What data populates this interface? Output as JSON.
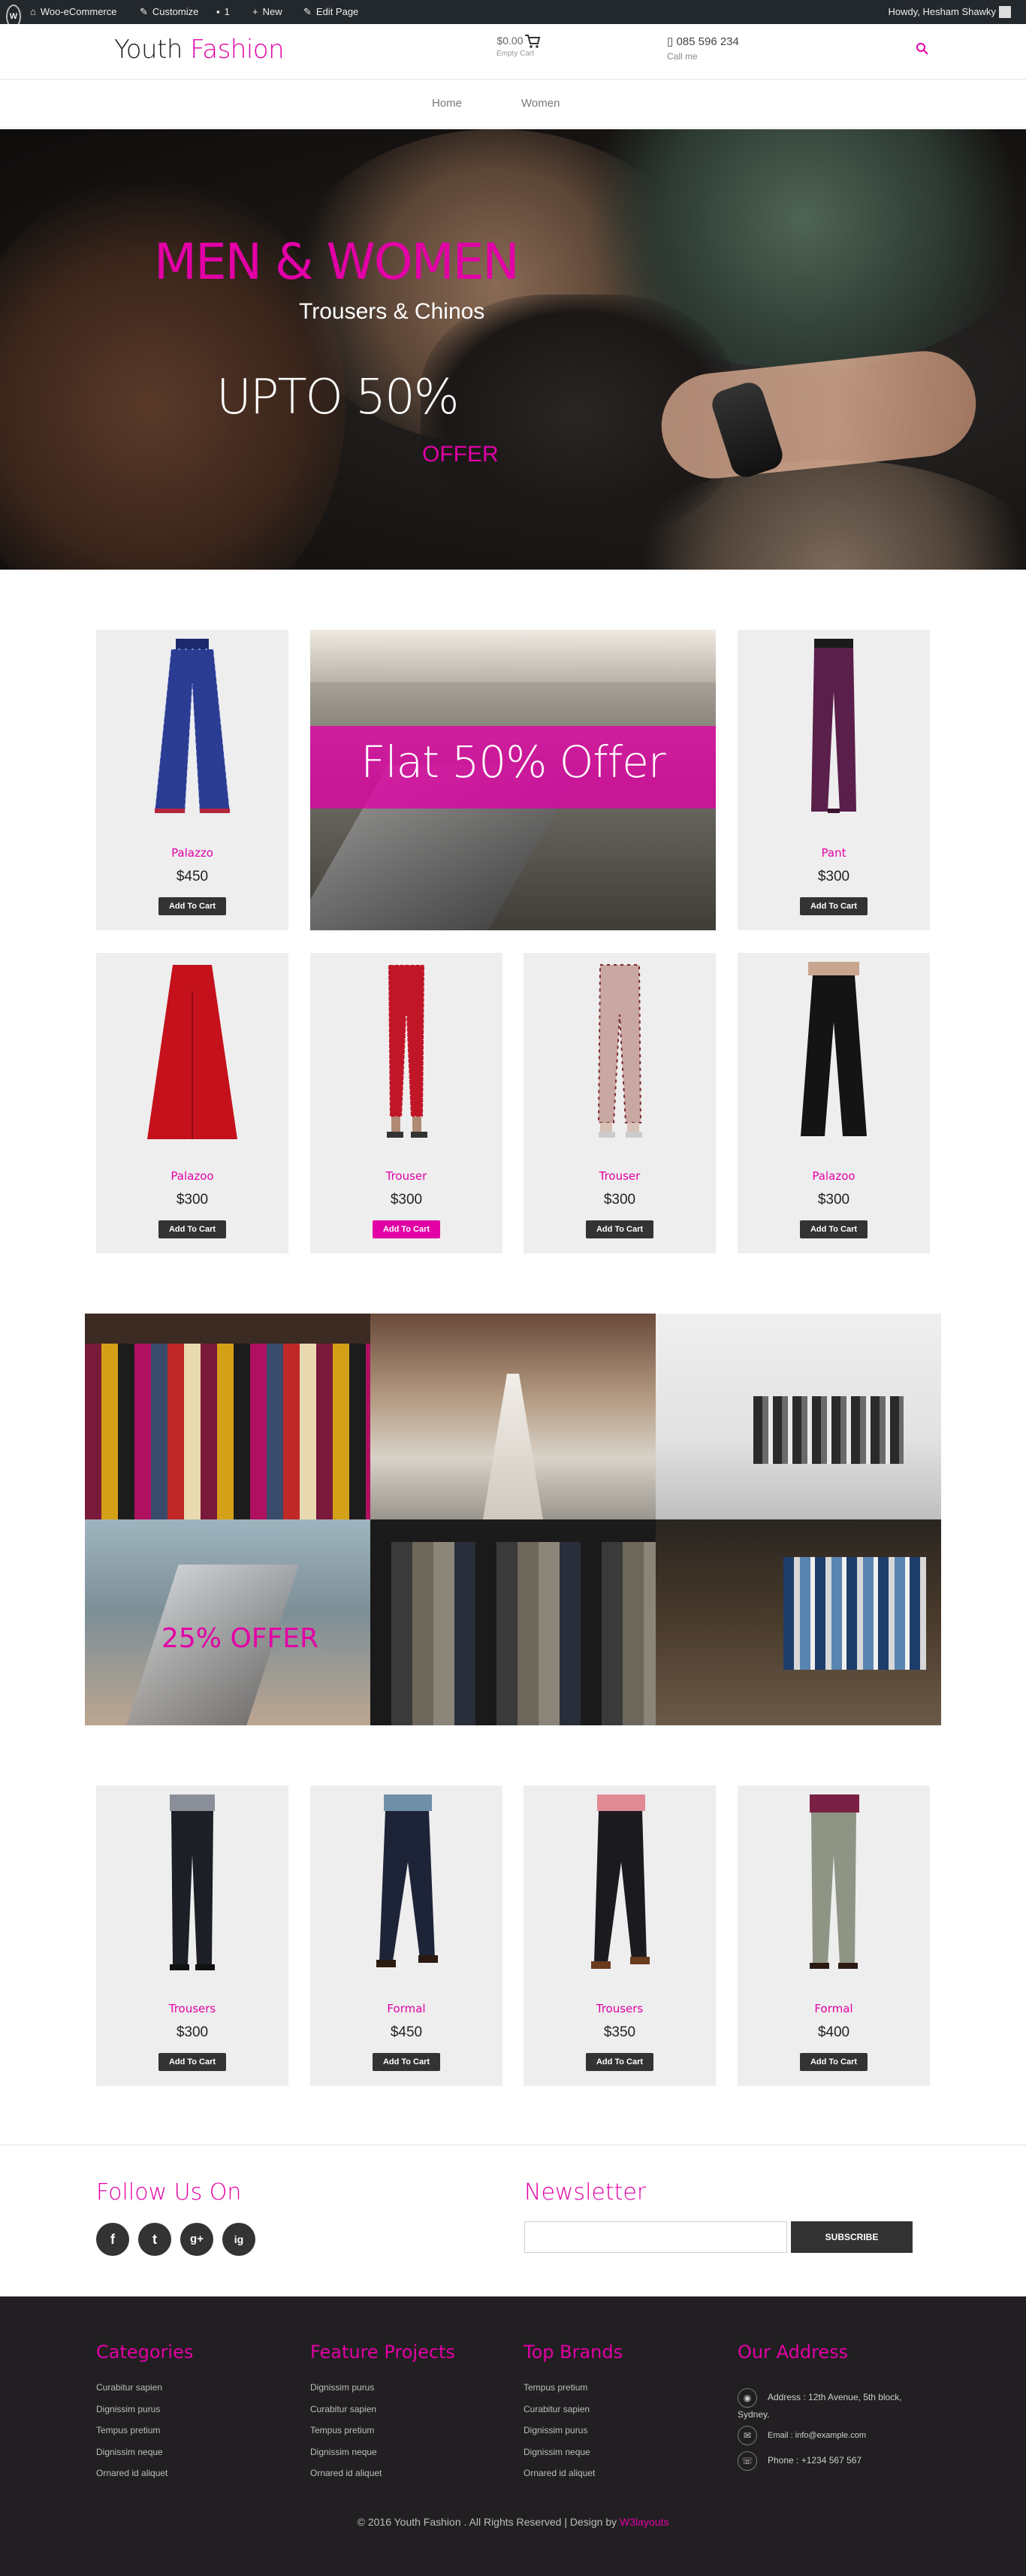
{
  "adminbar": {
    "site": "Woo-eCommerce",
    "customize": "Customize",
    "comments": "1",
    "new": "New",
    "edit": "Edit Page",
    "howdy": "Howdy, Hesham Shawky"
  },
  "header": {
    "logo_main": "Youth ",
    "logo_accent": "Fashion",
    "cart_amount": "$0.00",
    "cart_label": "Empty Cart",
    "phone": "085 596 234",
    "phone_label": "Call me"
  },
  "nav": {
    "items": [
      "Home",
      "Women"
    ]
  },
  "hero": {
    "title": "MEN & WOMEN",
    "subtitle": "Trousers & Chinos",
    "upto": "UPTO 50%",
    "offer": "OFFER"
  },
  "promo": {
    "text": "Flat 50% Offer"
  },
  "products": [
    {
      "name": "Palazzo",
      "price": "$450",
      "button": "Add To Cart"
    },
    {
      "name": "Pant",
      "price": "$300",
      "button": "Add To Cart"
    },
    {
      "name": "Palazoo",
      "price": "$300",
      "button": "Add To Cart"
    },
    {
      "name": "Trouser",
      "price": "$300",
      "button": "Add To Cart"
    },
    {
      "name": "Trouser",
      "price": "$300",
      "button": "Add To Cart"
    },
    {
      "name": "Palazoo",
      "price": "$300",
      "button": "Add To Cart"
    },
    {
      "name": "Trousers",
      "price": "$300",
      "button": "Add To Cart"
    },
    {
      "name": "Formal",
      "price": "$450",
      "button": "Add To Cart"
    },
    {
      "name": "Trousers",
      "price": "$350",
      "button": "Add To Cart"
    },
    {
      "name": "Formal",
      "price": "$400",
      "button": "Add To Cart"
    }
  ],
  "collage": {
    "text": "25% OFFER"
  },
  "follow": {
    "title": "Follow Us On",
    "icons": [
      "f",
      "t",
      "g+",
      "ig"
    ]
  },
  "newsletter": {
    "title": "Newsletter",
    "button": "SUBSCRIBE",
    "value": ""
  },
  "footer": {
    "categories": {
      "title": "Categories",
      "items": [
        "Curabitur sapien",
        "Dignissim purus",
        "Tempus pretium",
        "Dignissim neque",
        "Ornared id aliquet"
      ]
    },
    "features": {
      "title": "Feature Projects",
      "items": [
        "Dignissim purus",
        "Curabitur sapien",
        "Tempus pretium",
        "Dignissim neque",
        "Ornared id aliquet"
      ]
    },
    "brands": {
      "title": "Top Brands",
      "items": [
        "Tempus pretium",
        "Curabitur sapien",
        "Dignissim purus",
        "Dignissim neque",
        "Ornared id aliquet"
      ]
    },
    "address": {
      "title": "Our Address",
      "line1": "Address : 12th Avenue, 5th block,",
      "line1b": "Sydney.",
      "email": "Email : info@example.com",
      "phone": "Phone : +1234 567 567"
    },
    "copyright": "© 2016 Youth Fashion . All Rights Reserved | Design by ",
    "designer": "W3layouts"
  },
  "colors": {
    "accent": "#e200a6",
    "footer_bg": "#221f22",
    "adminbar_bg": "#23282d",
    "card_bg": "#eeeeee"
  }
}
